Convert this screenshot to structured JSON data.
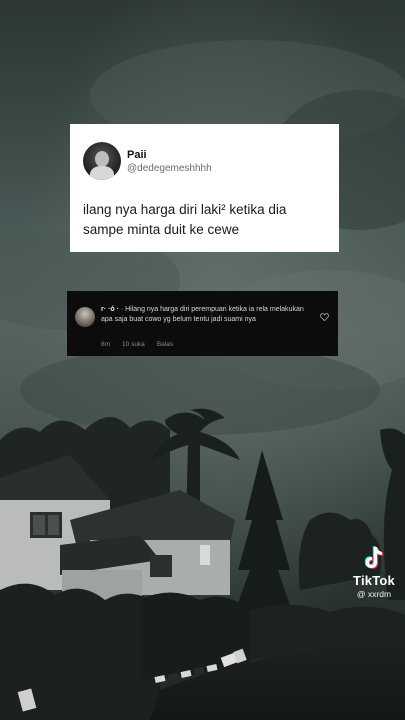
{
  "tweet": {
    "name": "Paii",
    "handle": "@dedegemeshhhh",
    "text_line1": "ilang nya harga diri laki² ketika dia",
    "text_line2": "sampe minta duit ke cewe"
  },
  "comment": {
    "username": "r· ·ó ·",
    "text": "Hilang nya harga diri perempuan ketika ia rela melakukan apa saja buat cowo yg belum tentu jadi suami nya",
    "time": "8m",
    "likes": "10 suka",
    "reply": "Balas"
  },
  "watermark": {
    "brand": "TikTok",
    "handle": "@ xxrdm"
  },
  "icons": {
    "heart": "heart-outline-icon",
    "tiktok": "tiktok-note-icon"
  },
  "colors": {
    "tiktok_cyan": "#25f4ee",
    "tiktok_red": "#fe2c55"
  }
}
